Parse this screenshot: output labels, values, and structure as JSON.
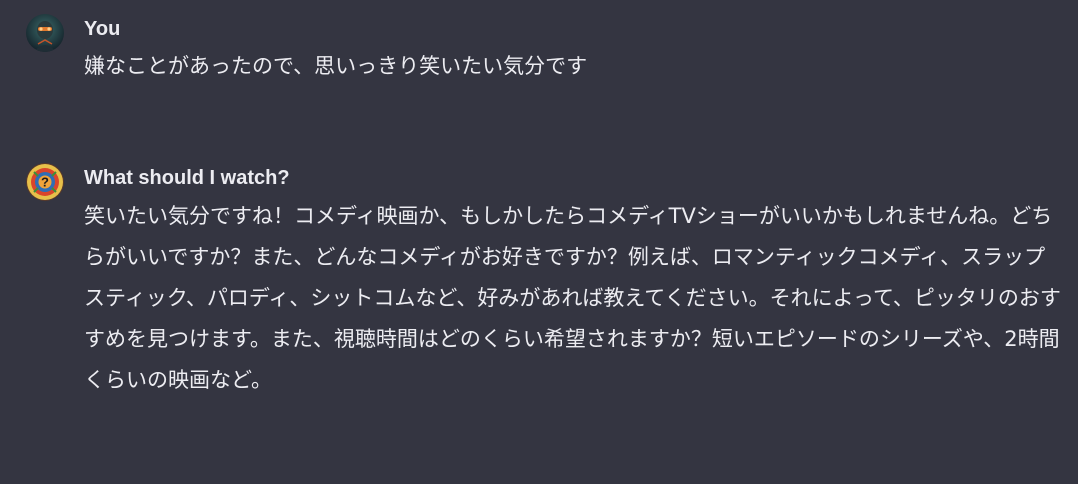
{
  "messages": [
    {
      "author": "You",
      "avatar_icon": "user-avatar-icon",
      "text": "嫌なことがあったので、思いっきり笑いたい気分です"
    },
    {
      "author": "What should I watch?",
      "avatar_icon": "gpt-avatar-icon",
      "text": "笑いたい気分ですね！コメディ映画か、もしかしたらコメディTVショーがいいかもしれませんね。どちらがいいですか？また、どんなコメディがお好きですか？例えば、ロマンティックコメディ、スラップスティック、パロディ、シットコムなど、好みがあれば教えてください。それによって、ピッタリのおすすめを見つけます。また、視聴時間はどのくらい希望されますか？短いエピソードのシリーズや、2時間くらいの映画など。"
    }
  ],
  "colors": {
    "background": "#343541",
    "text": "#ececf1"
  }
}
